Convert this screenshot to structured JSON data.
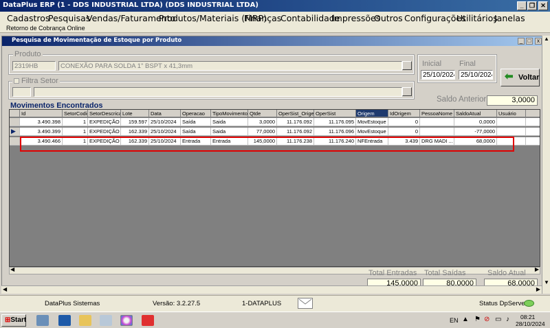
{
  "window": {
    "title": "DataPlus ERP (1 - DDS INDUSTRIAL LTDA)   (DDS INDUSTRIAL LTDA)"
  },
  "menu": [
    "Cadastros",
    "Pesquisas",
    "Vendas/Faturamento",
    "Produtos/Materiais (MRP)",
    "Finanças",
    "Contabilidade",
    "Impressões",
    "Outros",
    "Configurações",
    "Utilitários",
    "Janelas"
  ],
  "submenu": "Retorno de Cobrança Online",
  "inner": {
    "title": "Pesquisa de Movimentação de Estoque por Produto",
    "produto_label": "Produto",
    "produto_code": "2319HB",
    "produto_desc": "CONEXÃO PARA SOLDA 1\" BSPT x 41,3mm",
    "inicial_label": "Inicial",
    "inicial_value": "25/10/2024",
    "final_label": "Final",
    "final_value": "25/10/2024",
    "voltar_label": "Voltar",
    "filtra_setor_label": "Filtra Setor",
    "saldo_anterior_label": "Saldo Anterior",
    "saldo_anterior_value": "3,0000",
    "movimentos_label": "Movimentos Encontrados"
  },
  "grid": {
    "columns": [
      "Id",
      "SetorCodigo",
      "SetorDescricao",
      "Lote",
      "Data",
      "Operacao",
      "TipoMovimento",
      "Qtde",
      "OperSist_Origem",
      "OperSist",
      "Origem",
      "IdOrigem",
      "PessoaNome",
      "SaldoAtual",
      "Usuário"
    ],
    "rows": [
      [
        "3.490.398",
        "1",
        "EXPEDIÇÃO",
        "159.597",
        "25/10/2024",
        "Saída",
        "Saida",
        "3,0000",
        "11.176.092",
        "11.176.095",
        "MovEstoque",
        "0",
        "",
        "0,0000",
        ""
      ],
      [
        "3.490.399",
        "1",
        "EXPEDIÇÃO",
        "162.339",
        "25/10/2024",
        "Saída",
        "Saida",
        "77,0000",
        "11.176.092",
        "11.176.096",
        "MovEstoque",
        "0",
        "",
        "-77,0000",
        ""
      ],
      [
        "3.490.466",
        "1",
        "EXPEDIÇÃO",
        "162.339",
        "25/10/2024",
        "Entrada",
        "Entrada",
        "145,0000",
        "11.176.238",
        "11.176.240",
        "NFEntrada",
        "3.439",
        "DRG MADI ...",
        "68,0000",
        ""
      ]
    ]
  },
  "totals": {
    "entradas_label": "Total Entradas",
    "entradas_value": "145,0000",
    "saidas_label": "Total Saídas",
    "saidas_value": "80,0000",
    "saldo_label": "Saldo Atual",
    "saldo_value": "68,0000"
  },
  "status": {
    "company": "DataPlus Sistemas",
    "version": "Versão: 3.2.27.5",
    "user": "1-DATAPLUS",
    "server": "Status DpServer"
  },
  "taskbar": {
    "start": "Start",
    "lang": "EN",
    "time": "08:21",
    "date": "28/10/2024"
  },
  "colors": {
    "highlight": "#e00000",
    "accent": "#0a246a"
  }
}
